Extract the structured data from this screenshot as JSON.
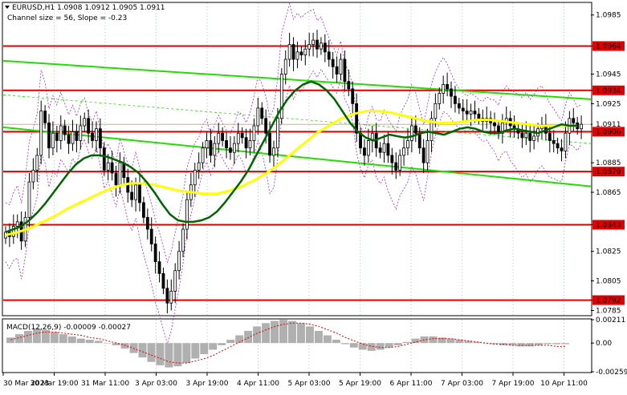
{
  "header": {
    "symbol_line": "EURUSD,H1  1.0908 1.0912 1.0905 1.0911",
    "channel_line": "Channel size = 56, Slope = -0.23"
  },
  "macd": {
    "label": "MACD(12,26,9) -0.00009 -0.00027",
    "axis_ticks": [
      "0.00211",
      "0.00",
      "-0.00259"
    ]
  },
  "colors": {
    "candle": "#000000",
    "level_line": "#e00000",
    "channel_line": "#22dd00",
    "ma_fast": "#006400",
    "ma_slow": "#ffff00",
    "bollinger": "#9b30d0",
    "price_label_bg": "#e00000",
    "macd_hist": "#b0b0b0",
    "macd_signal": "#e00000"
  },
  "chart_data": {
    "type": "candlestick",
    "symbol": "EURUSD",
    "timeframe": "H1",
    "ohlc": {
      "open": 1.0908,
      "high": 1.0912,
      "low": 1.0905,
      "close": 1.0911
    },
    "ylim": [
      1.0782,
      1.0993
    ],
    "y_ticks": [
      "1.0985",
      "1.0964",
      "1.0945",
      "1.0934",
      "1.0925",
      "1.0911",
      "1.0906",
      "1.0885",
      "1.0879",
      "1.0865",
      "1.0843",
      "1.0825",
      "1.0805",
      "1.0792",
      "1.0785"
    ],
    "horizontal_levels": [
      "1.0964",
      "1.0934",
      "1.0906",
      "1.0879",
      "1.0843",
      "1.0792"
    ],
    "current_price": "1.0911",
    "x_labels": [
      "30 Mar 2023",
      "30 Mar 19:00",
      "31 Mar 11:00",
      "3 Apr 03:00",
      "3 Apr 19:00",
      "4 Apr 11:00",
      "5 Apr 03:00",
      "5 Apr 19:00",
      "6 Apr 11:00",
      "7 Apr 03:00",
      "7 Apr 19:00",
      "10 Apr 11:00"
    ],
    "closes": [
      1.0838,
      1.0835,
      1.0842,
      1.0845,
      1.0832,
      1.0848,
      1.0872,
      1.088,
      1.089,
      1.092,
      1.0912,
      1.0895,
      1.0905,
      1.09,
      1.091,
      1.0904,
      1.0898,
      1.0906,
      1.09,
      1.091,
      1.0915,
      1.0905,
      1.09,
      1.0908,
      1.0895,
      1.088,
      1.0885,
      1.0878,
      1.087,
      1.0885,
      1.0875,
      1.0865,
      1.086,
      1.087,
      1.0858,
      1.0848,
      1.084,
      1.083,
      1.0818,
      1.081,
      1.08,
      1.079,
      1.0798,
      1.0812,
      1.0825,
      1.084,
      1.086,
      1.087,
      1.088,
      1.0885,
      1.0895,
      1.09,
      1.089,
      1.0898,
      1.0905,
      1.09,
      1.0895,
      1.0892,
      1.0898,
      1.0905,
      1.0902,
      1.0895,
      1.09,
      1.091,
      1.0922,
      1.0915,
      1.0905,
      1.089,
      1.0895,
      1.0915,
      1.0945,
      1.0955,
      1.0965,
      1.0955,
      1.096,
      1.0958,
      1.0962,
      1.0965,
      1.0968,
      1.0962,
      1.0966,
      1.096,
      1.0955,
      1.095,
      1.0945,
      1.0955,
      1.094,
      1.0935,
      1.0925,
      1.0905,
      1.0895,
      1.089,
      1.09,
      1.0905,
      1.0895,
      1.0892,
      1.0898,
      1.089,
      1.0885,
      1.088,
      1.089,
      1.0895,
      1.09,
      1.091,
      1.0905,
      1.0895,
      1.0885,
      1.09,
      1.0915,
      1.0925,
      1.0932,
      1.0938,
      1.0935,
      1.093,
      1.0925,
      1.0922,
      1.092,
      1.0918,
      1.092,
      1.0918,
      1.0915,
      1.0913,
      1.0915,
      1.0912,
      1.091,
      1.0905,
      1.0912,
      1.0915,
      1.091,
      1.0908,
      1.0905,
      1.0902,
      1.0905,
      1.09,
      1.0903,
      1.0908,
      1.091,
      1.0905,
      1.09,
      1.0898,
      1.0895,
      1.0893,
      1.0905,
      1.0915,
      1.0912,
      1.0908,
      1.0911
    ],
    "ma_fast": [
      1.0838,
      1.084,
      1.0842,
      1.0846,
      1.0851,
      1.0857,
      1.0864,
      1.0871,
      1.0878,
      1.0884,
      1.0888,
      1.089,
      1.089,
      1.0889,
      1.0887,
      1.0885,
      1.0882,
      1.0878,
      1.0872,
      1.0865,
      1.0857,
      1.085,
      1.0846,
      1.0845,
      1.0845,
      1.0846,
      1.0848,
      1.0852,
      1.0858,
      1.0865,
      1.0872,
      1.088,
      1.089,
      1.09,
      1.091,
      1.092,
      1.0928,
      1.0934,
      1.0938,
      1.094,
      1.0938,
      1.0934,
      1.0928,
      1.092,
      1.0912,
      1.0906,
      1.0902,
      1.09,
      1.0902,
      1.0904,
      1.0903,
      1.0902,
      1.0903,
      1.0905,
      1.0906,
      1.0905,
      1.0904,
      1.0906,
      1.0908,
      1.0909,
      1.0908,
      1.0906,
      1.0905,
      1.0905,
      1.0907,
      1.0908,
      1.0907,
      1.0906,
      1.0905,
      1.0907,
      1.0909,
      1.0911,
      1.091,
      1.091
    ],
    "ma_slow": [
      1.0836,
      1.0838,
      1.0841,
      1.0845,
      1.0849,
      1.0854,
      1.0858,
      1.0862,
      1.0866,
      1.0869,
      1.0871,
      1.0871,
      1.087,
      1.0868,
      1.0866,
      1.0865,
      1.0864,
      1.0864,
      1.0866,
      1.0869,
      1.0873,
      1.0878,
      1.0884,
      1.0891,
      1.0898,
      1.0905,
      1.091,
      1.0915,
      1.0918,
      1.092,
      1.092,
      1.0919,
      1.0917,
      1.0915,
      1.0913,
      1.0912,
      1.0912,
      1.0913,
      1.0914,
      1.0914,
      1.0913,
      1.0912,
      1.0911,
      1.091,
      1.091,
      1.091,
      1.091
    ],
    "macd_hist": [
      0.0005,
      0.0008,
      0.0011,
      0.0013,
      0.0012,
      0.001,
      0.0008,
      0.0006,
      0.0004,
      0.0003,
      0.0002,
      0.0,
      -0.0002,
      -0.0005,
      -0.0009,
      -0.0013,
      -0.0017,
      -0.002,
      -0.0022,
      -0.0021,
      -0.0018,
      -0.0014,
      -0.001,
      -0.0006,
      -0.0002,
      0.0003,
      0.0007,
      0.0011,
      0.0015,
      0.0018,
      0.002,
      0.0021,
      0.002,
      0.0018,
      0.0015,
      0.0011,
      0.0007,
      0.0003,
      -0.0001,
      -0.0004,
      -0.0006,
      -0.0007,
      -0.0006,
      -0.0004,
      -0.0002,
      0.0001,
      0.0004,
      0.0006,
      0.0006,
      0.0005,
      0.0004,
      0.0003,
      0.0002,
      0.0001,
      0.0,
      -0.0001,
      -0.0002,
      -0.0002,
      -0.0003,
      -0.0003,
      -0.0002,
      -0.0001,
      -0.0001,
      -0.0001
    ],
    "macd_signal": [
      0.0003,
      0.0005,
      0.0007,
      0.0009,
      0.001,
      0.001,
      0.0009,
      0.0008,
      0.0007,
      0.0005,
      0.0004,
      0.0002,
      0.0,
      -0.0002,
      -0.0005,
      -0.0008,
      -0.0011,
      -0.0014,
      -0.0017,
      -0.0018,
      -0.0018,
      -0.0016,
      -0.0014,
      -0.0011,
      -0.0007,
      -0.0003,
      0.0001,
      0.0005,
      0.0009,
      0.0012,
      0.0015,
      0.0017,
      0.0018,
      0.0018,
      0.0017,
      0.0015,
      0.0012,
      0.0009,
      0.0005,
      0.0002,
      -0.0001,
      -0.0003,
      -0.0004,
      -0.0004,
      -0.0003,
      -0.0001,
      0.0001,
      0.0003,
      0.0004,
      0.0004,
      0.0004,
      0.0003,
      0.0002,
      0.0001,
      0.0,
      -0.0001,
      -0.0001,
      -0.0002,
      -0.0002,
      -0.0002,
      -0.0002,
      -0.0002,
      -0.0003,
      -0.0003
    ],
    "macd_ylim": [
      -0.00259,
      0.00211
    ]
  }
}
